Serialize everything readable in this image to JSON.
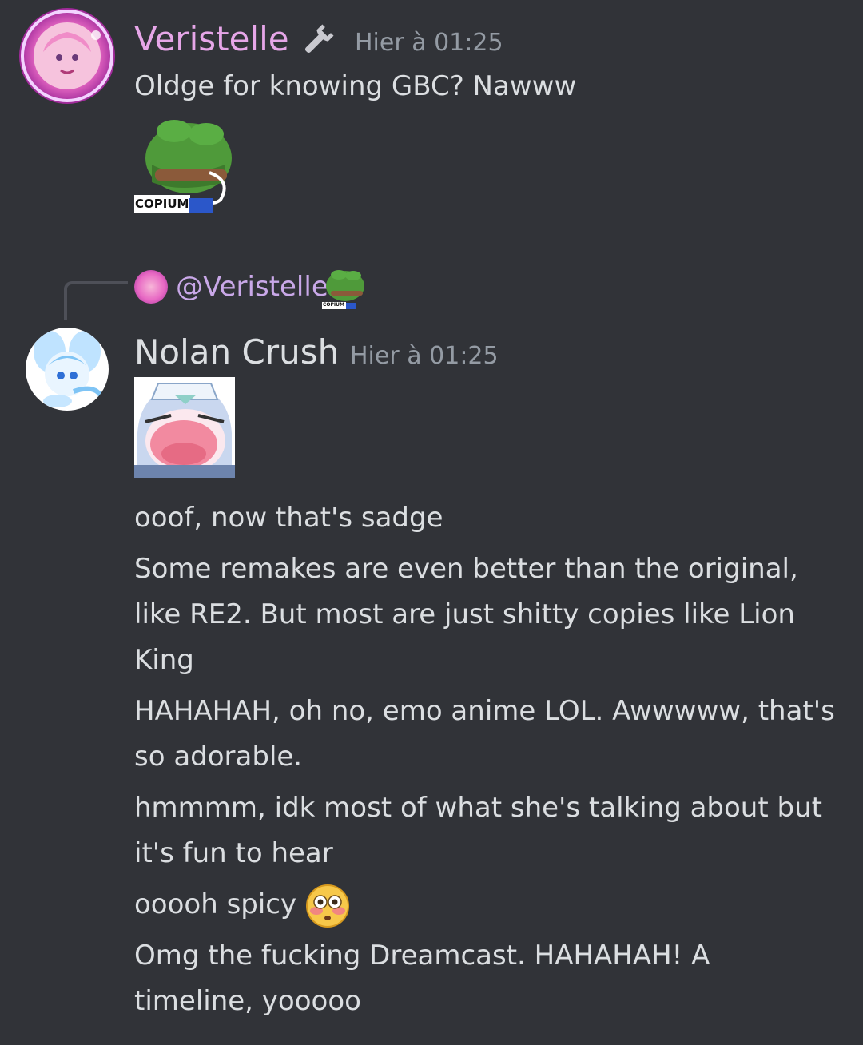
{
  "colors": {
    "background": "#313338",
    "text": "#dbdee1",
    "timestamp": "#949ba4",
    "veristelle_name": "#e6a6e8",
    "nolan_name": "#dbdee1",
    "reply_line": "#4e5058"
  },
  "message1": {
    "username": "Veristelle",
    "role_icon": "wrench-icon",
    "timestamp": "Hier à 01:25",
    "text": "Oldge for knowing GBC? Nawww",
    "sticker": {
      "icon": "copium-pepe-emoji",
      "label": "COPIUM"
    }
  },
  "reply": {
    "mention": "@Veristelle",
    "sticker_label": "COPIUM"
  },
  "message2": {
    "username": "Nolan Crush",
    "timestamp": "Hier à 01:25",
    "sticker": {
      "icon": "anime-crying-emoji"
    },
    "lines": [
      "ooof, now that's sadge",
      "Some remakes are even better than the original, like RE2. But most are just shitty copies like Lion King",
      "HAHAHAH, oh no, emo anime LOL. Awwwww, that's so adorable.",
      "hmmmm, idk most of what she's talking about but it's fun to hear",
      "ooooh spicy",
      "Omg the fucking Dreamcast. HAHAHAH! A timeline, yooooo"
    ],
    "inline_emoji": "flushed-face-emoji"
  }
}
